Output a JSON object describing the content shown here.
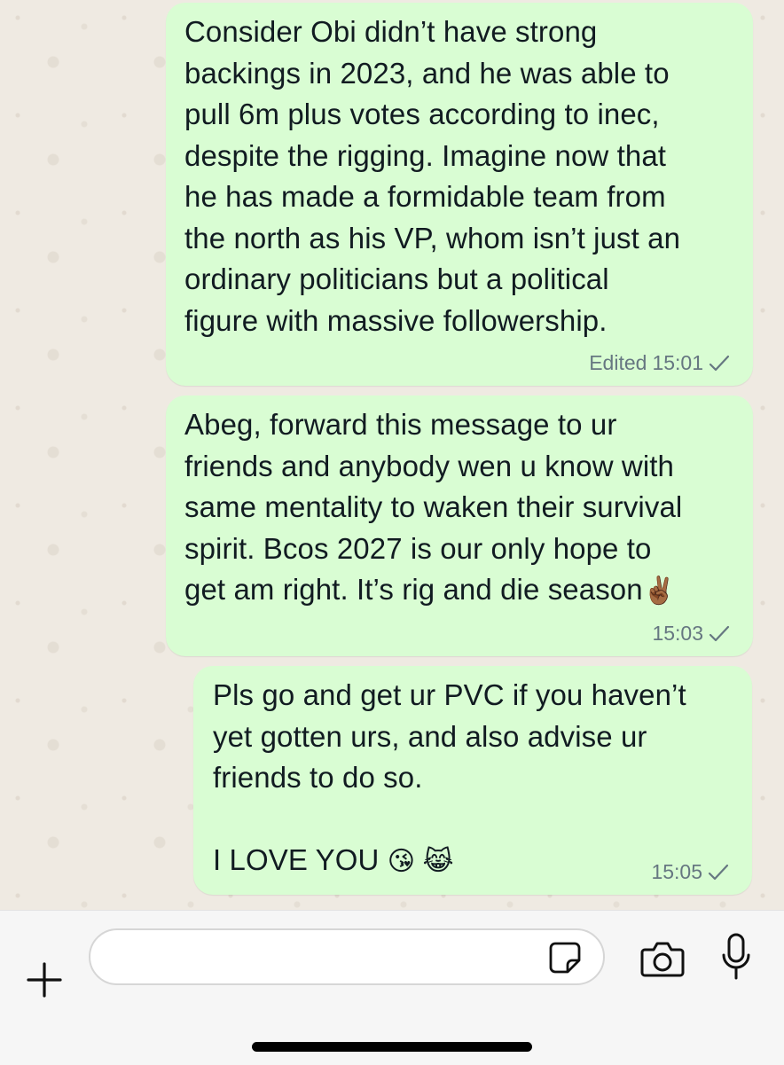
{
  "messages": [
    {
      "text": "Consider Obi didn’t have strong\nbackings in 2023, and he was able to\npull 6m plus votes according to inec,\ndespite the rigging. Imagine now that\nhe has made a formidable team from\nthe north as his VP, whom isn’t just an\nordinary politicians but a political\nfigure with massive followership.",
      "edited_label": "Edited",
      "time": "15:01",
      "status_icon": "single-check-icon"
    },
    {
      "text": "Abeg, forward this message to ur\nfriends and anybody wen u know with\nsame mentality to waken their survival\nspirit. Bcos 2027 is our only hope to\nget am right. It’s rig and die season",
      "emoji": "✌🏾",
      "time": "15:03",
      "status_icon": "single-check-icon"
    },
    {
      "text": "Pls go and get ur PVC if you haven’t\nyet gotten urs, and also advise ur\nfriends to do so.\n\nI LOVE YOU ",
      "emoji": "😘 😹",
      "time": "15:05",
      "status_icon": "single-check-icon"
    }
  ],
  "composer": {
    "value": "",
    "icons": [
      "plus-icon",
      "sticker-icon",
      "camera-icon",
      "microphone-icon"
    ]
  },
  "colors": {
    "outgoing_bubble": "#d9fdd3",
    "chat_background": "#efeae2",
    "meta_text": "#667781"
  }
}
